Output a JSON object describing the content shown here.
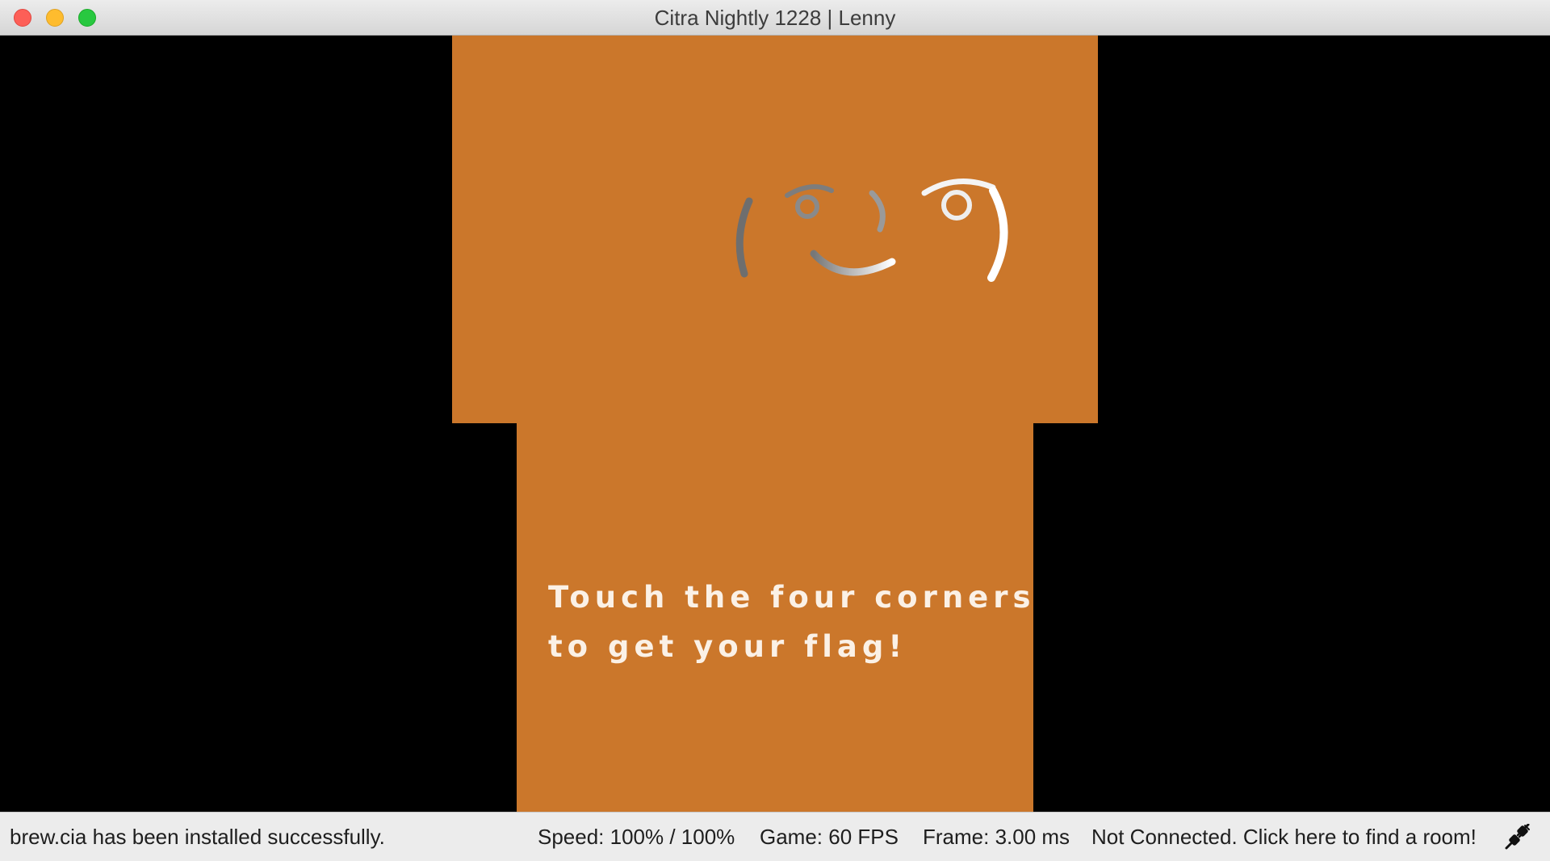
{
  "window": {
    "title": "Citra Nightly 1228 | Lenny"
  },
  "game": {
    "face_text": "( ͡° ͜ʖ ͡°)",
    "prompt_lines": [
      "Touch the four corners",
      "to get your flag!"
    ],
    "screen_color": "#cb772b"
  },
  "statusbar": {
    "message": "brew.cia has been installed successfully.",
    "speed": "Speed: 100% / 100%",
    "fps": "Game: 60 FPS",
    "frame": "Frame: 3.00 ms",
    "network": "Not Connected. Click here to find a room!",
    "network_icon": "disconnected-plug-icon"
  }
}
